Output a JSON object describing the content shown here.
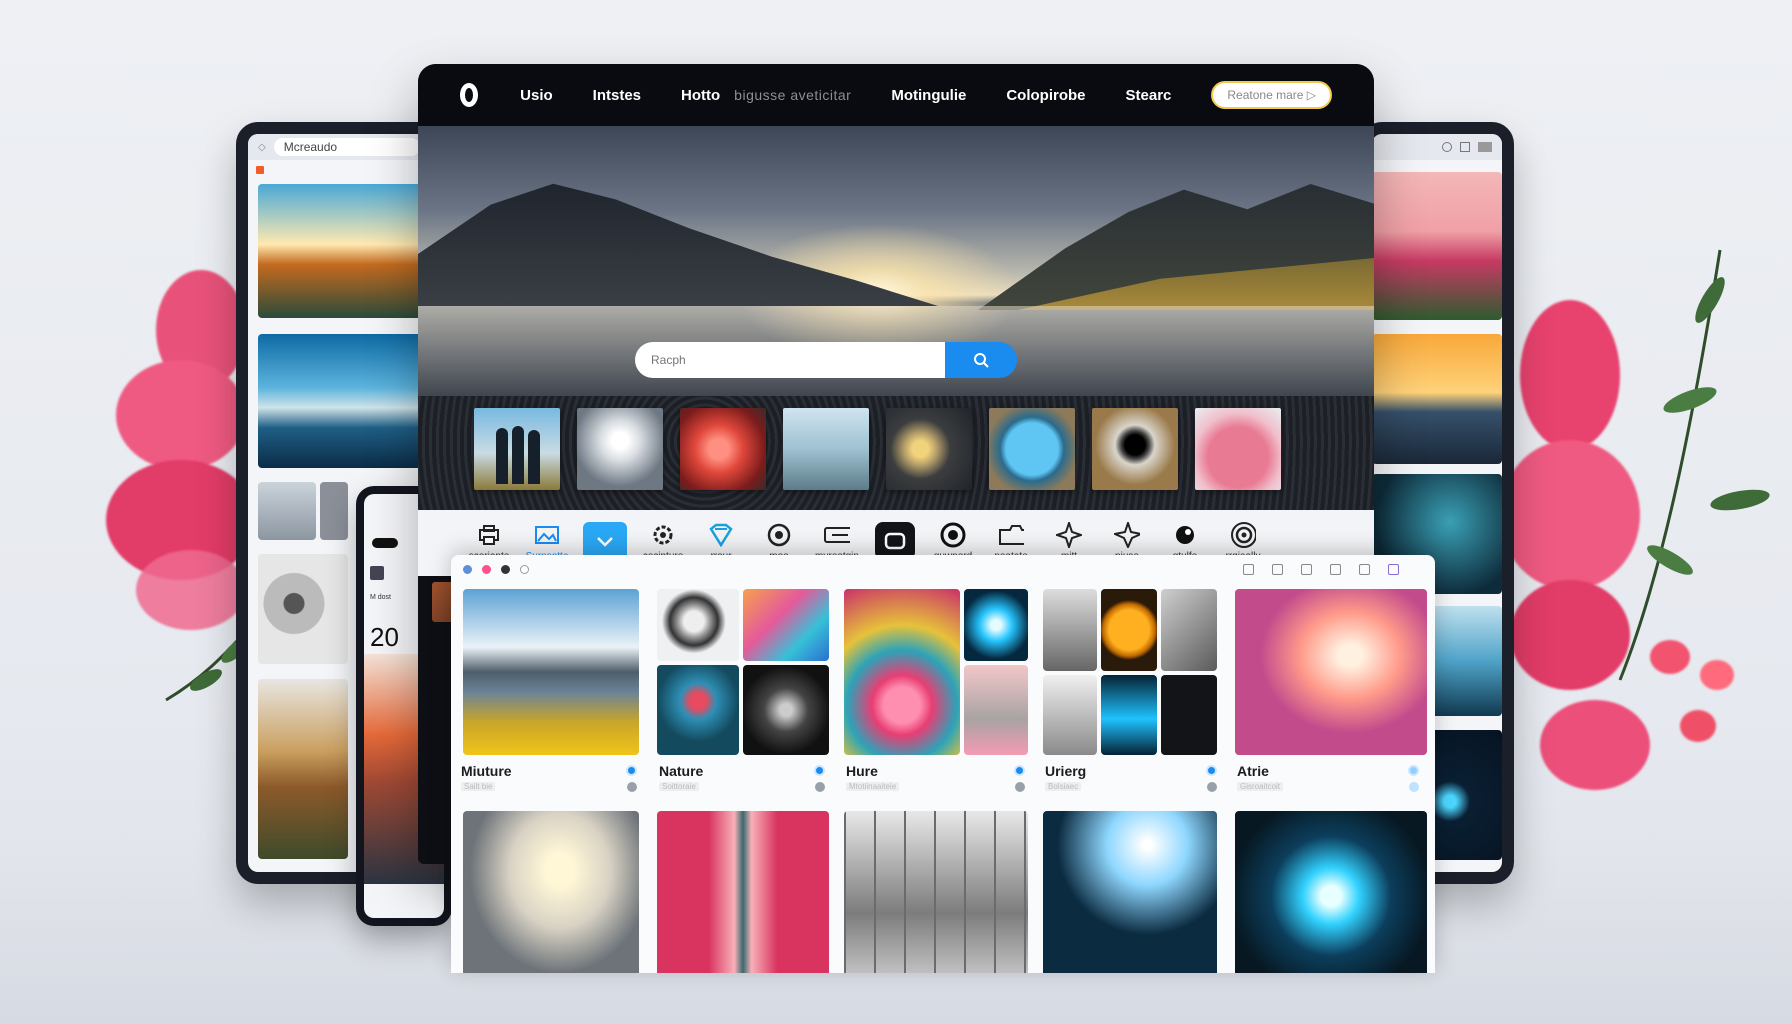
{
  "nav": {
    "items": [
      "Usio",
      "Intstes",
      "Hotto",
      "Motingulie",
      "Colopirobe",
      "Stearc"
    ],
    "muted_text": "bigusse aveticitar",
    "cta_label": "Reatone mare ▷"
  },
  "search": {
    "placeholder": "Racph"
  },
  "icon_bar": [
    {
      "label": "sceriante",
      "icon": "printer-icon"
    },
    {
      "label": "Surnsotte",
      "icon": "image-frame-icon"
    },
    {
      "label": "",
      "icon": "chevron-down-icon"
    },
    {
      "label": "cecipture",
      "icon": "gear-icon"
    },
    {
      "label": "rrour",
      "icon": "diamond-icon"
    },
    {
      "label": "moo",
      "icon": "circle-target-icon"
    },
    {
      "label": "myreotgin",
      "icon": "key-icon"
    },
    {
      "label": "",
      "icon": "rounded-square-icon"
    },
    {
      "label": "guwnord",
      "icon": "lens-icon"
    },
    {
      "label": "neatate",
      "icon": "folder-icon"
    },
    {
      "label": "mitt",
      "icon": "sparkle-icon"
    },
    {
      "label": "piuse",
      "icon": "star-icon"
    },
    {
      "label": "gtulfe",
      "icon": "blob-icon"
    },
    {
      "label": "rrgieally",
      "icon": "target-ring-icon"
    }
  ],
  "left_tablet": {
    "url": "Mcreaudo"
  },
  "phone": {
    "number": "20",
    "label": "M dost"
  },
  "gallery": {
    "cards": [
      {
        "title": "Miuture",
        "subtitle": "Sailt bie"
      },
      {
        "title": "Nature",
        "subtitle": "Soittoraie"
      },
      {
        "title": "Hure",
        "subtitle": "Mtotiinaaiteie"
      },
      {
        "title": "Urierg",
        "subtitle": "Bolsiaec"
      },
      {
        "title": "Atrie",
        "subtitle": "Gisroaitcoit"
      }
    ]
  },
  "colors": {
    "accent": "#1a8cf0",
    "nav_bg": "#0a0b10",
    "flower": "#e8426e",
    "cta_border": "#f2c94c"
  }
}
